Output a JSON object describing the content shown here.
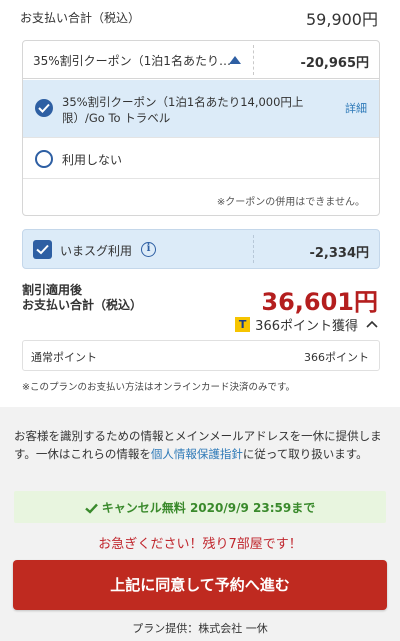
{
  "summary": {
    "total_label": "お支払い合計（税込）",
    "total_value": "59,900円"
  },
  "coupon": {
    "selected_label": "35%割引クーポン（1泊1名あたり…",
    "amount": "-20,965円",
    "options": [
      {
        "label": "35%割引クーポン（1泊1名あたり14,000円上限）/Go To トラベル",
        "selected": true,
        "detail_link": "詳細"
      },
      {
        "label": "利用しない",
        "selected": false
      }
    ],
    "note": "※クーポンの併用はできません。"
  },
  "imasugu": {
    "label": "いまスグ利用",
    "info_icon": "info-icon",
    "checked": true,
    "amount": "-2,334円"
  },
  "after_discount": {
    "label_line1": "割引適用後",
    "label_line2": "お支払い合計（税込）",
    "total": "36,601円",
    "total_color": "#b41e1e",
    "points_brand": "T",
    "points_text": "366ポイント獲得"
  },
  "normal_points": {
    "label": "通常ポイント",
    "value": "366ポイント"
  },
  "payment_note": "※このプランのお支払い方法はオンラインカード決済のみです。",
  "privacy": {
    "text_before": "お客様を識別するための情報とメインメールアドレスを一休に提供します。一休はこれらの情報を",
    "link": "個人情報保護指針",
    "text_after": "に従って取り扱います。"
  },
  "cancel": {
    "text": "キャンセル無料 2020/9/9 23:59まで",
    "color": "#3a8a2c"
  },
  "hurry": "お急ぎください！残り7部屋です！",
  "cta": {
    "label": "上記に同意して予約へ進む",
    "color": "#bf2a20"
  },
  "provider": "プラン提供：株式会社 一休",
  "accent_color": "#2e5fa3"
}
